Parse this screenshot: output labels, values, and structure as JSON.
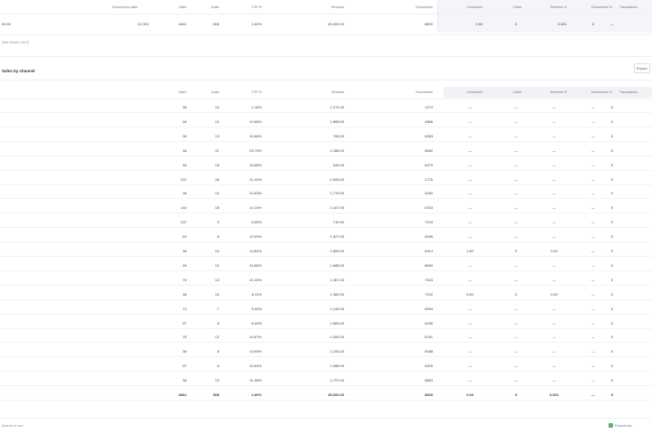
{
  "summary": {
    "headers": [
      "Ecommerce sales",
      "Sales",
      "Goals",
      "CTR %",
      "Revenue",
      "Ecommerce",
      "Conversion",
      "Clicks",
      "Revenue %",
      "Ecommerce %",
      "Transactions"
    ],
    "row": [
      "00:00",
      "10,000",
      "4461",
      "808",
      "1.60%",
      "45,000.00",
      "8600",
      "0.60",
      "0",
      "0.601",
      "0",
      "—"
    ],
    "note": "Date viewed: 06/13"
  },
  "section": {
    "title": "Sales by channel",
    "button_label": "Export"
  },
  "table": {
    "headers": [
      "Sales",
      "Goals",
      "CTR %",
      "Revenue",
      "Ecommerce",
      "Conversion",
      "Clicks",
      "Revenue %",
      "Ecommerce %",
      "Transactions"
    ],
    "rows": [
      [
        "36",
        "10",
        "1.18%",
        "1,274.00",
        "1274",
        "—",
        "—",
        "—",
        "—",
        "0"
      ],
      [
        "46",
        "10",
        "10.66%",
        "1,898.00",
        "4866",
        "—",
        "—",
        "—",
        "—",
        "0"
      ],
      [
        "36",
        "13",
        "10.66%",
        "768.00",
        "6063",
        "—",
        "—",
        "—",
        "—",
        "0"
      ],
      [
        "46",
        "21",
        "29.70%",
        "1,286.00",
        "6562",
        "—",
        "—",
        "—",
        "—",
        "0"
      ],
      [
        "46",
        "18",
        "16.66%",
        "646.00",
        "6470",
        "—",
        "—",
        "—",
        "—",
        "0"
      ],
      [
        "137",
        "28",
        "21.40%",
        "2,605.00",
        "2776",
        "—",
        "—",
        "—",
        "—",
        "0"
      ],
      [
        "36",
        "10",
        "10.83%",
        "1,775.00",
        "6282",
        "—",
        "—",
        "—",
        "—",
        "0"
      ],
      [
        "144",
        "18",
        "14.14%",
        "2,167.00",
        "6763",
        "—",
        "—",
        "—",
        "—",
        "0"
      ],
      [
        "137",
        "9",
        "6.56%",
        "710.00",
        "7104",
        "—",
        "—",
        "—",
        "—",
        "0"
      ],
      [
        "63",
        "8",
        "12.90%",
        "1,327.00",
        "6285",
        "—",
        "—",
        "—",
        "—",
        "0"
      ],
      [
        "46",
        "10",
        "14.84%",
        "1,806.00",
        "6314",
        "1.60",
        "0",
        "0.62",
        "—",
        "0"
      ],
      [
        "46",
        "10",
        "15.86%",
        "1,688.00",
        "6660",
        "—",
        "—",
        "—",
        "—",
        "0"
      ],
      [
        "76",
        "13",
        "21.40%",
        "1,367.00",
        "7024",
        "—",
        "—",
        "—",
        "—",
        "0"
      ],
      [
        "36",
        "13",
        "8.11%",
        "1,360.00",
        "7102",
        "0.60",
        "0",
        "0.62",
        "—",
        "0"
      ],
      [
        "74",
        "7",
        "5.40%",
        "1,144.00",
        "6094",
        "—",
        "—",
        "—",
        "—",
        "0"
      ],
      [
        "97",
        "8",
        "8.40%",
        "1,869.00",
        "6185",
        "—",
        "—",
        "—",
        "—",
        "0"
      ],
      [
        "76",
        "13",
        "10.57%",
        "1,005.00",
        "6761",
        "—",
        "—",
        "—",
        "—",
        "0"
      ],
      [
        "36",
        "8",
        "14.90%",
        "1,153.00",
        "6088",
        "—",
        "—",
        "—",
        "—",
        "0"
      ],
      [
        "97",
        "8",
        "10.64%",
        "1,986.00",
        "6300",
        "—",
        "—",
        "—",
        "—",
        "0"
      ],
      [
        "36",
        "13",
        "11.36%",
        "1,707.00",
        "6863",
        "—",
        "—",
        "—",
        "—",
        "0"
      ]
    ],
    "totals": [
      "4861",
      "808",
      "1.60%",
      "45,000.00",
      "8600",
      "0.60",
      "0",
      "0.601",
      "—",
      "0"
    ]
  },
  "footer": {
    "left": "Data as of now",
    "right": "Powered by"
  },
  "colors": {
    "grid": "#f2f3f5",
    "shade": "#f1f2f6",
    "logo": "#62b06a"
  }
}
